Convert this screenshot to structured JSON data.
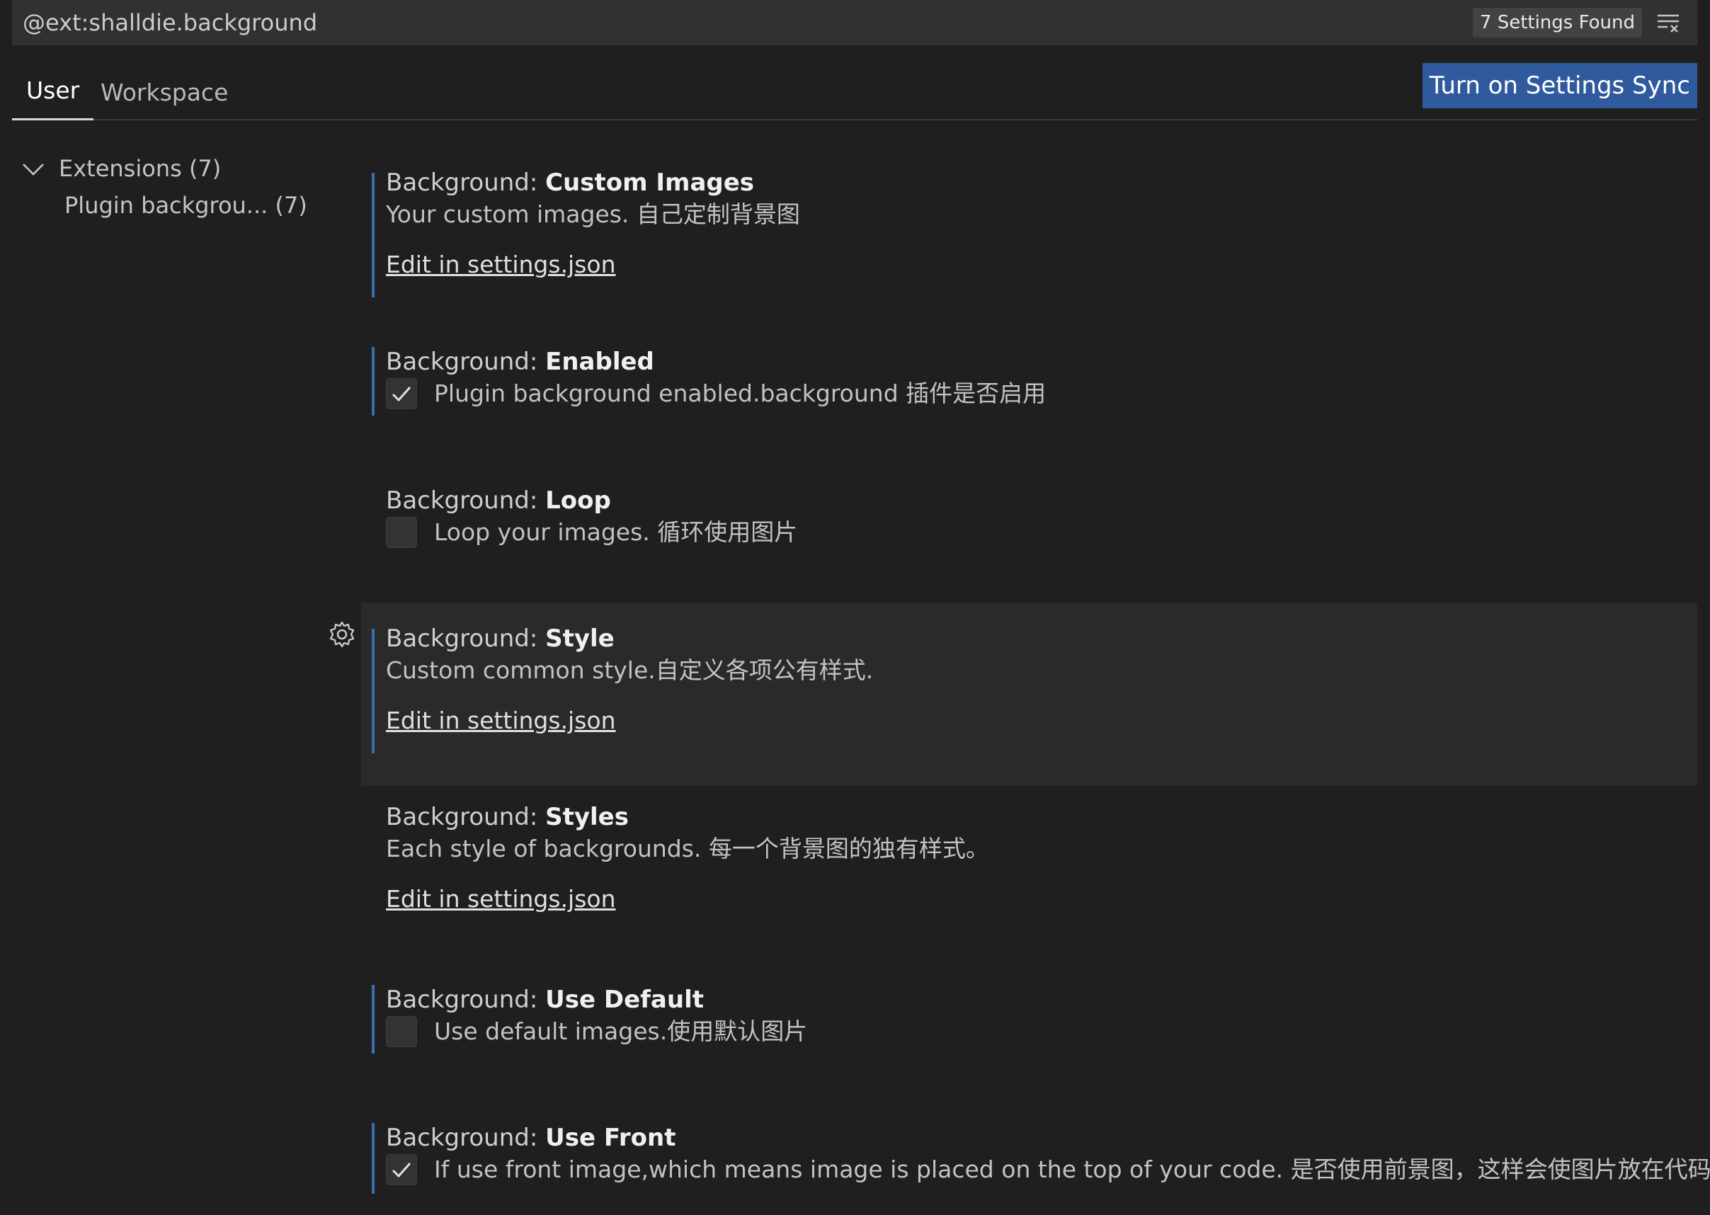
{
  "search": {
    "value": "@ext:shalldie.background",
    "results_label": "7 Settings Found"
  },
  "tabs": [
    {
      "label": "User",
      "active": true
    },
    {
      "label": "Workspace",
      "active": false
    }
  ],
  "sync_button_label": "Turn on Settings Sync",
  "toc": {
    "group_label": "Extensions (7)",
    "item_label": "Plugin backgrou... (7)"
  },
  "settings": [
    {
      "category": "Background: ",
      "name": "Custom Images",
      "description": "Your custom images. 自己定制背景图",
      "type": "json",
      "edit_label": "Edit in settings.json",
      "modified": true
    },
    {
      "category": "Background: ",
      "name": "Enabled",
      "description": "Plugin background enabled.background 插件是否启用",
      "type": "boolean",
      "checked": true,
      "modified": true
    },
    {
      "category": "Background: ",
      "name": "Loop",
      "description": "Loop your images. 循环使用图片",
      "type": "boolean",
      "checked": false,
      "modified": false
    },
    {
      "category": "Background: ",
      "name": "Style",
      "description": "Custom common style.自定义各项公有样式.",
      "type": "json",
      "edit_label": "Edit in settings.json",
      "modified": true,
      "focused": true
    },
    {
      "category": "Background: ",
      "name": "Styles",
      "description": "Each style of backgrounds. 每一个背景图的独有样式。",
      "type": "json",
      "edit_label": "Edit in settings.json",
      "modified": false
    },
    {
      "category": "Background: ",
      "name": "Use Default",
      "description": "Use default images.使用默认图片",
      "type": "boolean",
      "checked": false,
      "modified": true
    },
    {
      "category": "Background: ",
      "name": "Use Front",
      "description": "If use front image,which means image is placed on the top of your code. 是否使用前景图，这样会使图片放在代码的顶部",
      "type": "boolean",
      "checked": true,
      "modified": true
    }
  ],
  "colors": {
    "accent": "#3a6db2",
    "sync_button": "#2f5a9e",
    "background": "#1f1f1f"
  },
  "icons": {
    "clear_filter": "clear-filter-icon",
    "chevron": "chevron-down-icon",
    "gear": "gear-icon",
    "check": "check-icon"
  }
}
